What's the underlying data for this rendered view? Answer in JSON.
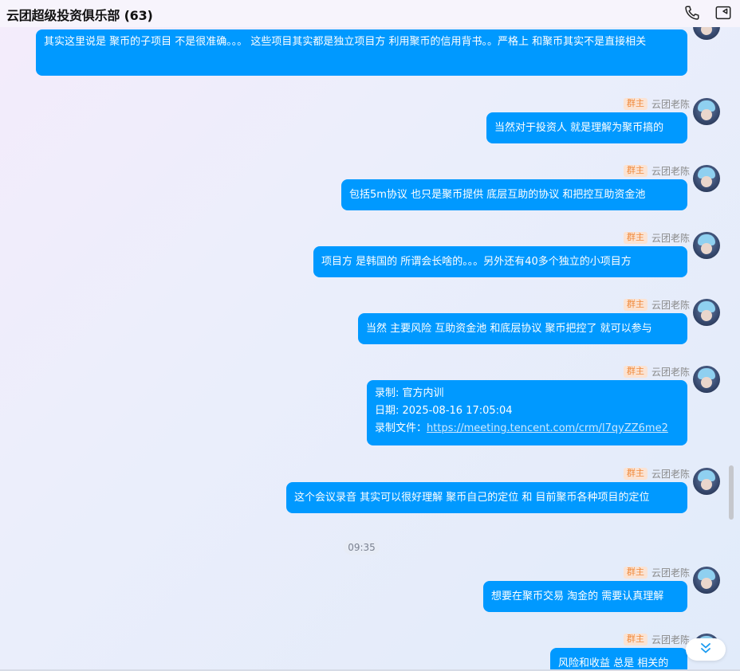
{
  "header": {
    "title": "云团超级投资俱乐部 (63)"
  },
  "sender": {
    "badge": "群主",
    "name": "云团老陈"
  },
  "messages": [
    {
      "text": "其实这里说是 聚币的子项目 不是很准确。。。 这些项目其实都是独立项目方 利用聚币的信用背书。。严格上 和聚币其实不是直接相关"
    },
    {
      "text": "当然对于投资人 就是理解为聚币搞的"
    },
    {
      "text": "包括5m协议 也只是聚币提供 底层互助的协议 和把控互助资金池"
    },
    {
      "text": "项目方 是韩国的 所谓会长啥的。。。另外还有40多个独立的小项目方"
    },
    {
      "text": "当然 主要风险 互助资金池 和底层协议 聚币把控了 就可以参与"
    },
    {
      "line1": "录制: 官方内训",
      "line2": "日期: 2025-08-16 17:05:04",
      "line3_prefix": "录制文件：",
      "link": "https://meeting.tencent.com/crm/l7qyZZ6me2"
    },
    {
      "text": "这个会议录音 其实可以很好理解 聚币自己的定位 和 目前聚币各种项目的定位"
    },
    {
      "text": "想要在聚币交易 淘金的 需要认真理解"
    },
    {
      "text": "风险和收益 总是 相关的"
    }
  ],
  "time_divider": "09:35",
  "icons": {
    "call": "phone-icon",
    "video": "video-icon",
    "scroll": "double-chevron-down-icon",
    "avatar": "avatar"
  },
  "colors": {
    "bubble": "#0099ff",
    "badge_bg": "#fbe3d3",
    "badge_text": "#f08a3c"
  }
}
